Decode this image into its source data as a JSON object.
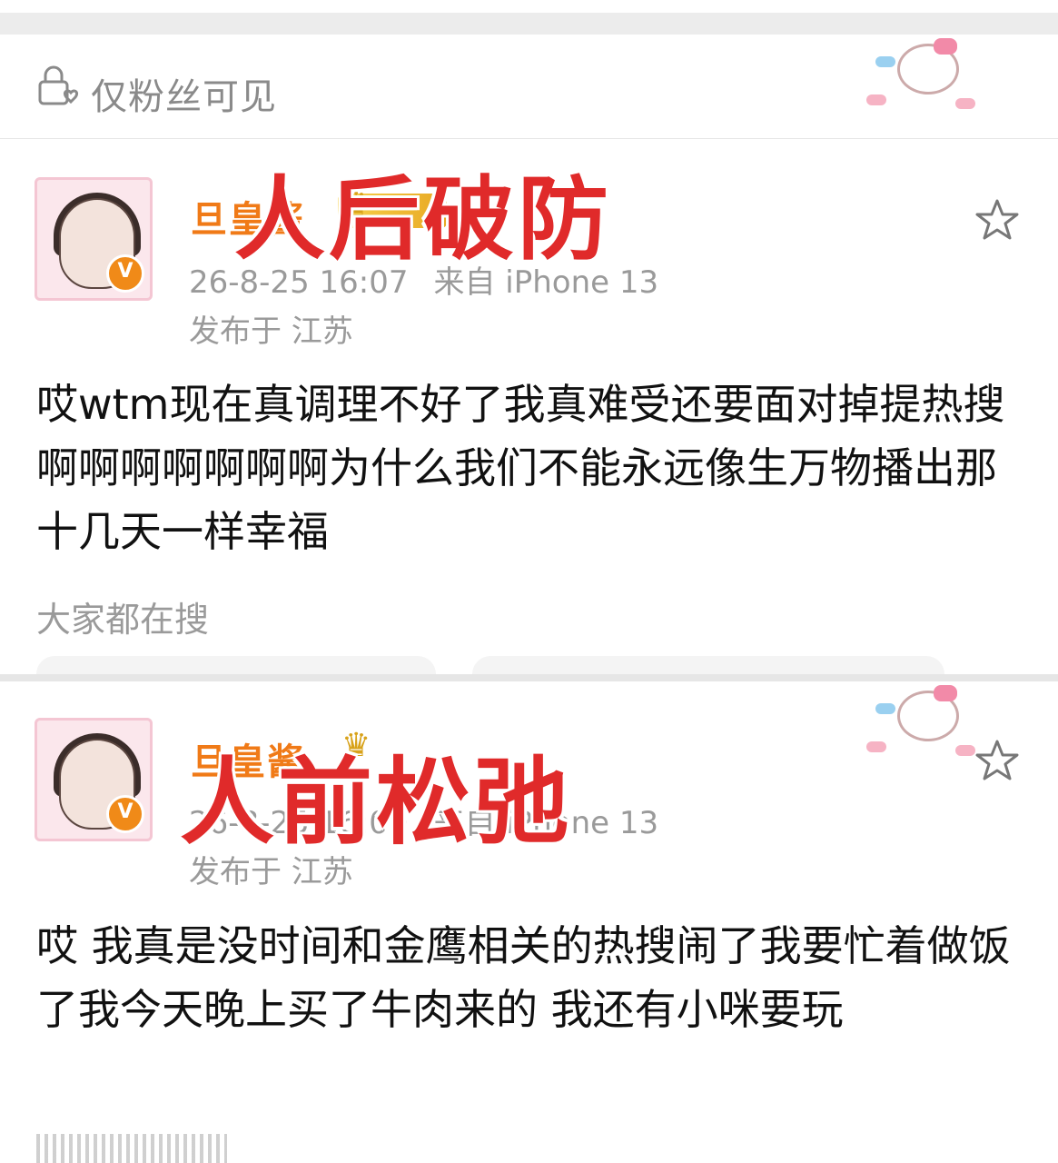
{
  "visibility": {
    "label": "仅粉丝可见"
  },
  "overlays": {
    "top": "人后破防",
    "bottom": "人前松弛"
  },
  "posts": [
    {
      "username": "旦皇酱",
      "time": "26-8-25 16:07",
      "source": "来自 iPhone 13",
      "region": "发布于 江苏",
      "content": "哎wtm现在真调理不好了我真难受还要面对掉提热搜啊啊啊啊啊啊啊为什么我们不能永远像生万物播出那十几天一样幸福",
      "hot_label": "大家都在搜"
    },
    {
      "username": "旦皇酱",
      "time": "26-8-25 16:09",
      "source": "来自 iPhone 13",
      "region": "发布于 江苏",
      "content": "哎 我真是没时间和金鹰相关的热搜闹了我要忙着做饭了我今天晚上买了牛肉来的 我还有小咪要玩"
    }
  ],
  "colors": {
    "accent": "#f07a17",
    "overlay": "#e02a2a",
    "meta": "#9a9a9a"
  },
  "icons": {
    "lock": "lock-fans-icon",
    "star": "star-outline-icon",
    "verified": "verified-v-icon"
  }
}
